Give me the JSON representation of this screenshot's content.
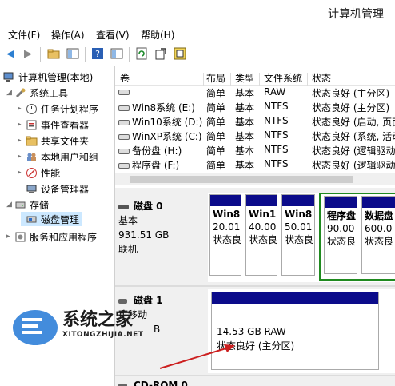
{
  "window": {
    "title": "计算机管理"
  },
  "menu": [
    "文件(F)",
    "操作(A)",
    "查看(V)",
    "帮助(H)"
  ],
  "tree": {
    "root": "计算机管理(本地)",
    "system_tools": "系统工具",
    "task_scheduler": "任务计划程序",
    "event_viewer": "事件查看器",
    "shared_folders": "共享文件夹",
    "local_users": "本地用户和组",
    "performance": "性能",
    "device_manager": "设备管理器",
    "storage": "存储",
    "disk_management": "磁盘管理",
    "services": "服务和应用程序"
  },
  "volumes": {
    "headers": [
      "卷",
      "布局",
      "类型",
      "文件系统",
      "状态"
    ],
    "rows": [
      {
        "name": "",
        "layout": "简单",
        "type": "基本",
        "fs": "RAW",
        "status": "状态良好 (主分区)"
      },
      {
        "name": "Win8系统 (E:)",
        "layout": "简单",
        "type": "基本",
        "fs": "NTFS",
        "status": "状态良好 (主分区)"
      },
      {
        "name": "Win10系统 (D:)",
        "layout": "简单",
        "type": "基本",
        "fs": "NTFS",
        "status": "状态良好 (启动, 页面"
      },
      {
        "name": "WinXP系统 (C:)",
        "layout": "简单",
        "type": "基本",
        "fs": "NTFS",
        "status": "状态良好 (系统, 活动"
      },
      {
        "name": "备份盘 (H:)",
        "layout": "简单",
        "type": "基本",
        "fs": "NTFS",
        "status": "状态良好 (逻辑驱动"
      },
      {
        "name": "程序盘 (F:)",
        "layout": "简单",
        "type": "基本",
        "fs": "NTFS",
        "status": "状态良好 (逻辑驱动"
      }
    ]
  },
  "disk0": {
    "name": "磁盘 0",
    "type": "基本",
    "size": "931.51 GB",
    "state": "联机",
    "parts": [
      {
        "l1": "Win8",
        "l2": "20.01",
        "l3": "状态良"
      },
      {
        "l1": "Win1",
        "l2": "40.00",
        "l3": "状态良"
      },
      {
        "l1": "Win8",
        "l2": "50.01",
        "l3": "状态良"
      },
      {
        "l1": "程序盘",
        "l2": "90.00",
        "l3": "状态良"
      },
      {
        "l1": "数据盘",
        "l2": "600.0",
        "l3": "状态良"
      }
    ]
  },
  "disk1": {
    "name": "磁盘 1",
    "type": "可移动",
    "size": "B",
    "part": {
      "size": "14.53 GB RAW",
      "status": "状态良好 (主分区)"
    }
  },
  "cdrom": {
    "name": "CD-ROM 0"
  },
  "watermark": {
    "brand": "系统之家",
    "url": "XITONGZHIJIA.NET"
  },
  "colors": {
    "partition_bar": "#0b0b8a",
    "logical_frame": "#1f8a1f",
    "selection": "#cce8ff",
    "arrow": "#cc1f1f"
  }
}
